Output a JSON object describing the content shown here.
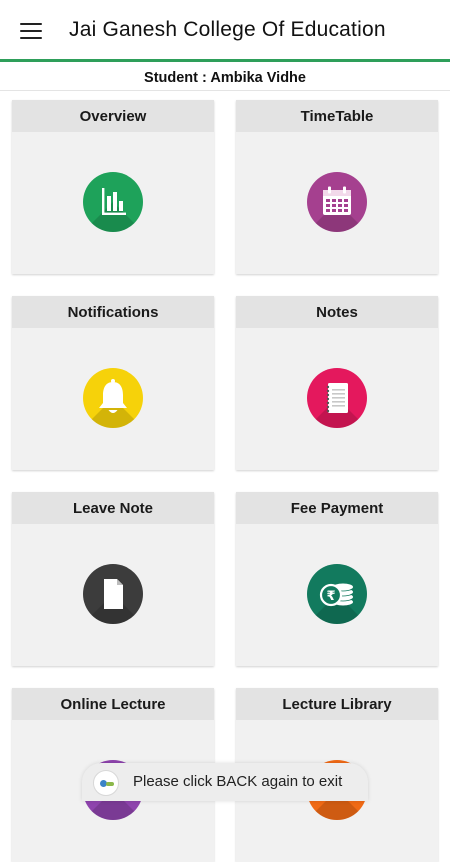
{
  "app": {
    "title": "Jai Ganesh College Of Education"
  },
  "student": {
    "label": "Student : Ambika Vidhe"
  },
  "tiles": [
    {
      "label": "Overview",
      "icon": "bar-chart-icon",
      "color": "#1ea25a"
    },
    {
      "label": "TimeTable",
      "icon": "calendar-icon",
      "color": "#a5408f"
    },
    {
      "label": "Notifications",
      "icon": "bell-icon",
      "color": "#f6d20a"
    },
    {
      "label": "Notes",
      "icon": "notepad-icon",
      "color": "#e4185d"
    },
    {
      "label": "Leave Note",
      "icon": "document-icon",
      "color": "#3c3c3c"
    },
    {
      "label": "Fee Payment",
      "icon": "rupee-coins-icon",
      "color": "#127a5e"
    },
    {
      "label": "Online Lecture",
      "icon": "lecture-icon",
      "color": "#8e44ad"
    },
    {
      "label": "Lecture Library",
      "icon": "library-icon",
      "color": "#f06a15"
    }
  ],
  "toast": {
    "message": "Please click BACK again to exit",
    "icon": "app-logo-icon"
  }
}
